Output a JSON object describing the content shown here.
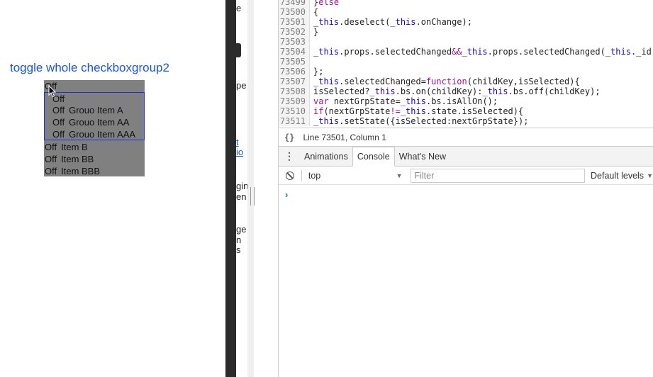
{
  "demo": {
    "toggle_link": "toggle whole checkboxgroup2",
    "group_header": "Off",
    "inner_group": [
      {
        "state": "Off",
        "label": ""
      },
      {
        "state": "Off",
        "label": "Grouo Item A"
      },
      {
        "state": "Off",
        "label": "Grouo Item AA"
      },
      {
        "state": "Off",
        "label": "Grouo Item AAA"
      }
    ],
    "outer_items": [
      {
        "state": "Off",
        "label": "Item B"
      },
      {
        "state": "Off",
        "label": "Item BB"
      },
      {
        "state": "Off",
        "label": "Item BBB"
      }
    ]
  },
  "middle_fragments": [
    "e",
    "pe",
    "t",
    "io",
    "gin",
    "en",
    "ge",
    "n",
    "s"
  ],
  "code": {
    "lines": [
      {
        "n": "73499",
        "text": "}else"
      },
      {
        "n": "73500",
        "text": "{"
      },
      {
        "n": "73501",
        "text": "_this.deselect(_this.onChange);"
      },
      {
        "n": "73502",
        "text": "}"
      },
      {
        "n": "73503",
        "text": ""
      },
      {
        "n": "73504",
        "text": "_this.props.selectedChanged&&_this.props.selectedChanged(_this._id"
      },
      {
        "n": "73505",
        "text": ""
      },
      {
        "n": "73506",
        "text": "};"
      },
      {
        "n": "73507",
        "text": "_this.selectedChanged=function(childKey,isSelected){"
      },
      {
        "n": "73508",
        "text": "isSelected?_this.bs.on(childKey):_this.bs.off(childKey);"
      },
      {
        "n": "73509",
        "text": "var nextGrpState=_this.bs.isAllOn();"
      },
      {
        "n": "73510",
        "text": "if(nextGrpState!=_this.state.isSelected){"
      },
      {
        "n": "73511",
        "text": "_this.setState({isSelected:nextGrpState});"
      }
    ]
  },
  "status": {
    "braces": "{}",
    "cursor_position": "Line 73501, Column 1"
  },
  "drawer": {
    "menu": "⋮",
    "tabs": [
      "Animations",
      "Console",
      "What's New"
    ],
    "active_tab": "Console"
  },
  "console": {
    "context": "top",
    "filter_placeholder": "Filter",
    "levels": "Default levels",
    "prompt": "›"
  }
}
